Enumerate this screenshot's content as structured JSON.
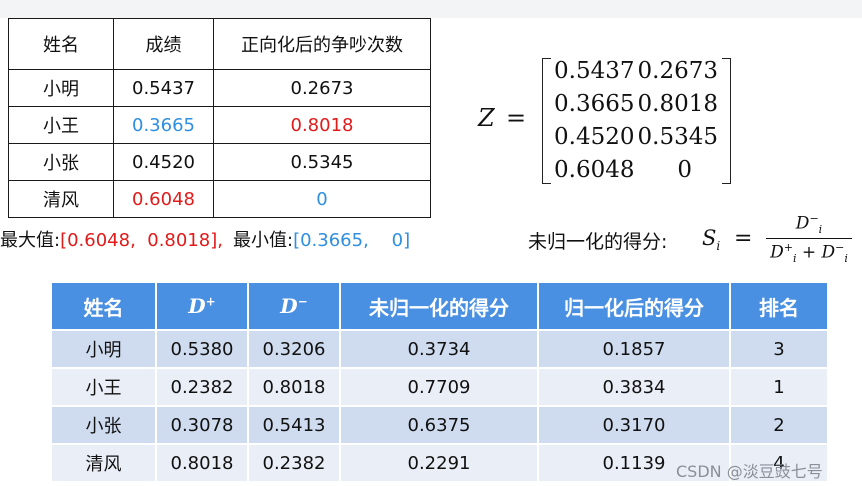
{
  "top_table": {
    "headers": [
      "姓名",
      "成绩",
      "正向化后的争吵次数"
    ],
    "rows": [
      [
        "小明",
        "0.5437",
        "0.2673"
      ],
      [
        "小王",
        "0.3665",
        "0.8018"
      ],
      [
        "小张",
        "0.4520",
        "0.5345"
      ],
      [
        "清风",
        "0.6048",
        "0"
      ]
    ],
    "colors": {
      "red": "#e11a1a",
      "blue": "#2f8fe0"
    }
  },
  "matrix": {
    "label": "Z",
    "eq": "=",
    "rows": [
      [
        "0.5437",
        "0.2673"
      ],
      [
        "0.3665",
        "0.8018"
      ],
      [
        "0.4520",
        "0.5345"
      ],
      [
        "0.6048",
        "0"
      ]
    ]
  },
  "maxmin": {
    "max_label": "最大值:",
    "max_value": "[0.6048,  0.8018],",
    "min_label": "最小值:",
    "min_value": "[0.3665,    0]"
  },
  "formula": {
    "text": "未归一化的得分:",
    "lhs": "S",
    "lhs_sub": "i",
    "eq": "=",
    "num": "D",
    "den_a": "D",
    "plus": " + ",
    "den_b": "D"
  },
  "bottom_table": {
    "headers": [
      "姓名",
      "D",
      "D",
      "未归一化的得分",
      "归一化后的得分",
      "排名"
    ],
    "header_sup": [
      "+",
      "−"
    ],
    "rows": [
      [
        "小明",
        "0.5380",
        "0.3206",
        "0.3734",
        "0.1857",
        "3"
      ],
      [
        "小王",
        "0.2382",
        "0.8018",
        "0.7709",
        "0.3834",
        "1"
      ],
      [
        "小张",
        "0.3078",
        "0.5413",
        "0.6375",
        "0.3170",
        "2"
      ],
      [
        "清风",
        "0.8018",
        "0.2382",
        "0.2291",
        "0.1139",
        "4"
      ]
    ],
    "colors": {
      "header": "#4a90e2",
      "row_dark": "#cfdcef",
      "row_light": "#e9eef7"
    }
  },
  "watermark": "CSDN @淡豆豉七号"
}
